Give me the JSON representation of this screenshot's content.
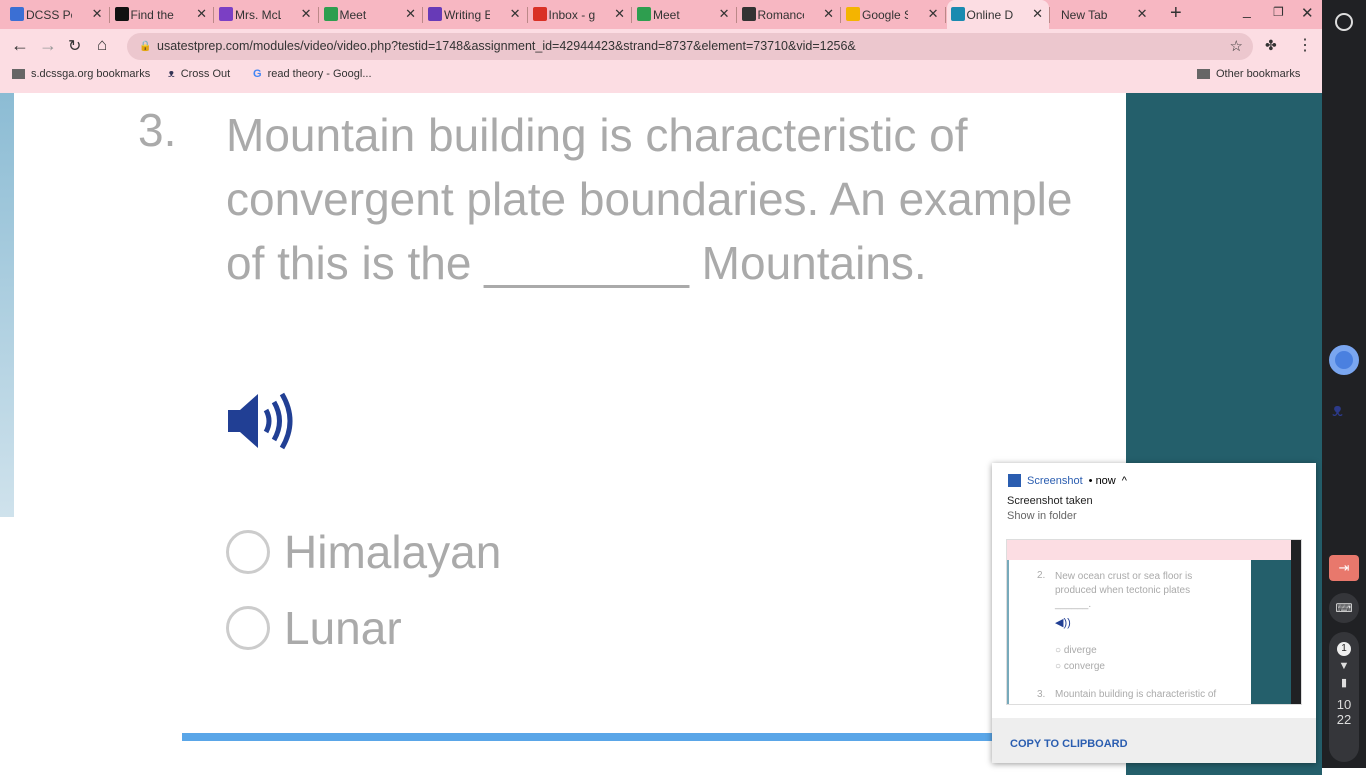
{
  "browser": {
    "tabs": [
      {
        "label": "DCSS Portal",
        "color": "#3b6fd4"
      },
      {
        "label": "Find the answer",
        "color": "#111"
      },
      {
        "label": "Mrs. McL",
        "color": "#7b3fc4"
      },
      {
        "label": "Meet",
        "color": "#2e9e4f"
      },
      {
        "label": "Writing E",
        "color": "#673ab7"
      },
      {
        "label": "Inbox - gr",
        "color": "#d93025"
      },
      {
        "label": "Meet",
        "color": "#2e9e4f"
      },
      {
        "label": "Romance",
        "color": "#333"
      },
      {
        "label": "Google Sl",
        "color": "#f4b400"
      },
      {
        "label": "Online Di",
        "color": "#1a8ab0"
      },
      {
        "label": "New Tab",
        "color": ""
      }
    ],
    "active_tab": 9,
    "url": "usatestprep.com/modules/video/video.php?testid=1748&assignment_id=42944423&strand=8737&element=73710&vid=1256&",
    "bookmarks": [
      "s.dcssga.org bookmarks",
      "Cross Out",
      "read theory - Googl..."
    ],
    "other_bookmarks": "Other bookmarks"
  },
  "question": {
    "number": "3.",
    "text": "Mountain building is characteristic of convergent plate boundaries. An example of this is the ________ Mountains.",
    "options": [
      "Himalayan",
      "Lunar"
    ]
  },
  "notification": {
    "app": "Screenshot",
    "time": "• now",
    "title": "Screenshot taken",
    "link": "Show in folder",
    "action": "COPY TO CLIPBOARD",
    "thumb": {
      "q2_number": "2.",
      "q2_text": "New ocean crust or sea floor is produced when tectonic plates ______.",
      "q2_options": [
        "diverge",
        "converge"
      ],
      "q3_number": "3.",
      "q3_text": "Mountain building is characteristic of"
    }
  },
  "shelf": {
    "notif_count": "1",
    "time_hour": "10",
    "time_min": "22"
  }
}
